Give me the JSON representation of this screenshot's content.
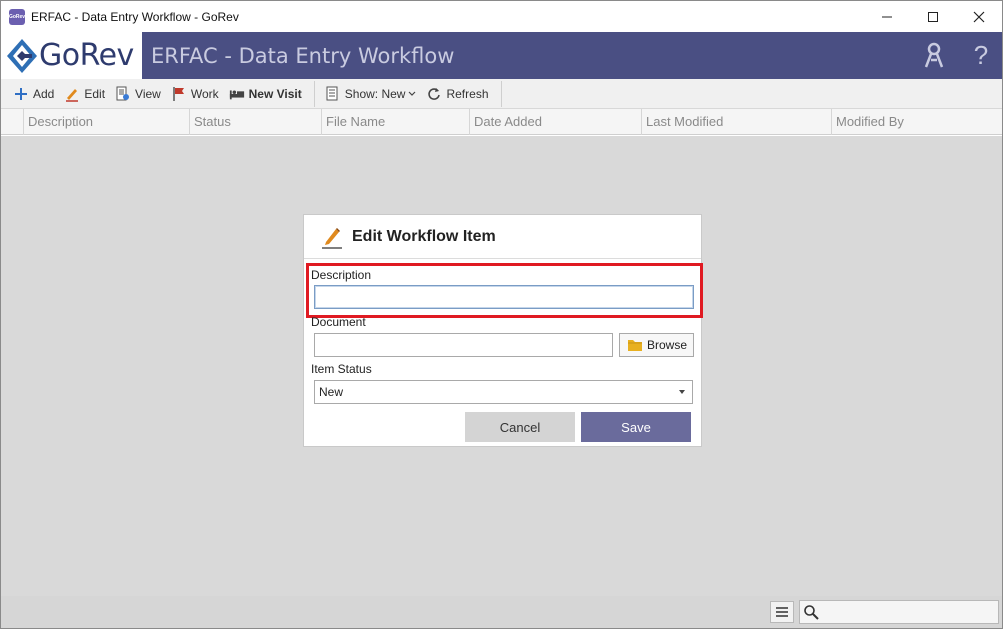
{
  "window": {
    "title": "ERFAC - Data Entry Workflow - GoRev",
    "app_icon_text": "GoRev",
    "controls": [
      "minimize",
      "maximize",
      "close"
    ]
  },
  "header": {
    "logo_text": "GoRev",
    "title": "ERFAC - Data Entry Workflow",
    "icons": [
      "user-keys-icon",
      "help-icon"
    ],
    "help_glyph": "?"
  },
  "toolbar": {
    "add_label": "Add",
    "edit_label": "Edit",
    "view_label": "View",
    "work_label": "Work",
    "new_visit_label": "New Visit",
    "show_label": "Show: New",
    "refresh_label": "Refresh"
  },
  "grid": {
    "columns": [
      "Description",
      "Status",
      "File Name",
      "Date Added",
      "Last Modified",
      "Modified By"
    ]
  },
  "dialog": {
    "title": "Edit Workflow Item",
    "description_label": "Description",
    "description_value": "",
    "document_label": "Document",
    "document_value": "",
    "browse_label": "Browse",
    "item_status_label": "Item Status",
    "item_status_value": "New",
    "cancel_label": "Cancel",
    "save_label": "Save"
  },
  "statusbar": {
    "search_value": ""
  },
  "colors": {
    "header_bg": "#4a4f83",
    "save_button": "#6a6b9c",
    "highlight": "#e01a22",
    "overlay": "#d9d9d9"
  }
}
